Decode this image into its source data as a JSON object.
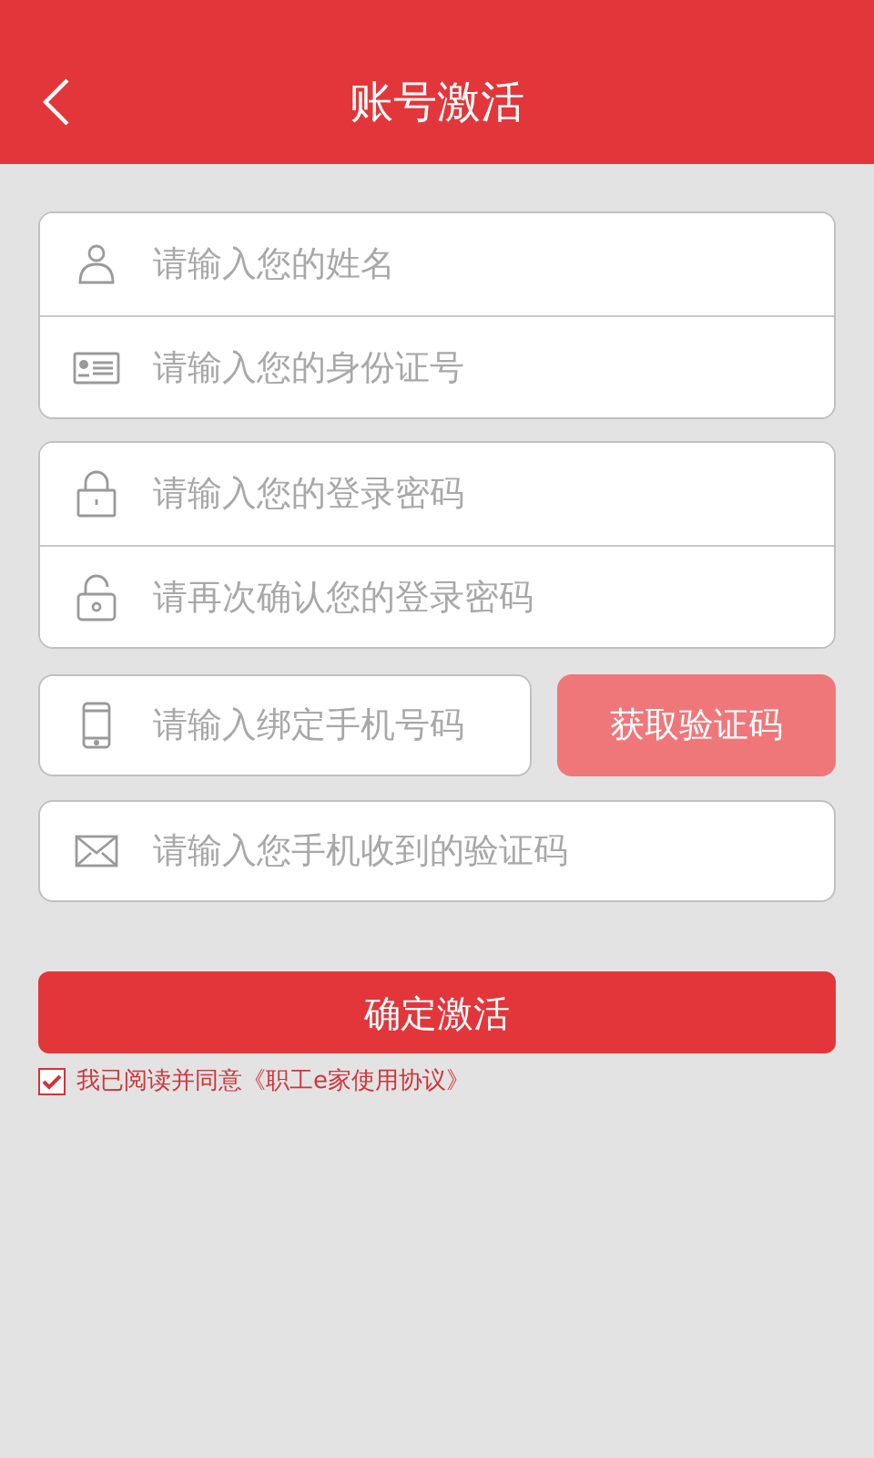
{
  "header": {
    "title": "账号激活"
  },
  "groups": [
    {
      "fields": [
        {
          "placeholder": "请输入您的姓名"
        },
        {
          "placeholder": "请输入您的身份证号"
        }
      ]
    },
    {
      "fields": [
        {
          "placeholder": "请输入您的登录密码"
        },
        {
          "placeholder": "请再次确认您的登录密码"
        }
      ]
    }
  ],
  "phone": {
    "placeholder": "请输入绑定手机号码"
  },
  "get_code_button": "获取验证码",
  "code": {
    "placeholder": "请输入您手机收到的验证码"
  },
  "submit_button": "确定激活",
  "agreement": {
    "checked": true,
    "text": "我已阅读并同意《职工e家使用协议》"
  }
}
